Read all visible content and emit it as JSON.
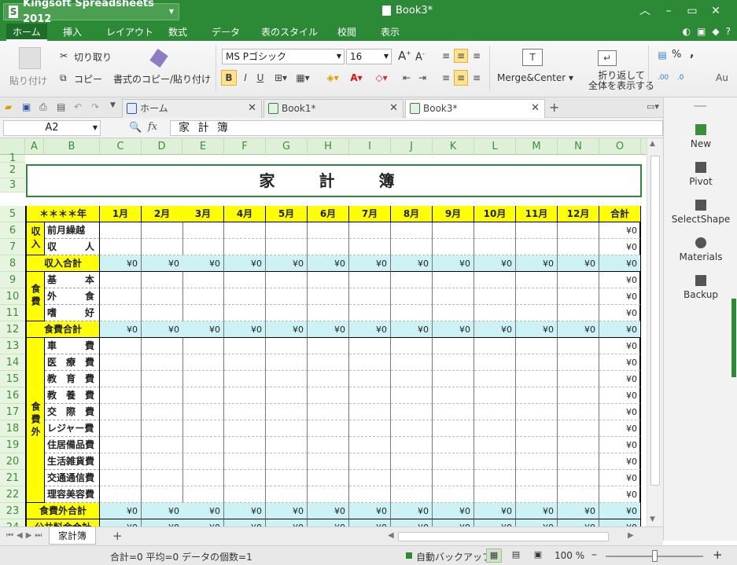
{
  "app": {
    "name": "Kingsoft Spreadsheets 2012",
    "doc_title": "Book3*"
  },
  "menu": [
    "ホーム",
    "挿入",
    "レイアウト",
    "数式",
    "データ",
    "表のスタイル",
    "校閲",
    "表示"
  ],
  "ribbon": {
    "paste": "貼り付け",
    "cut": "切り取り",
    "copy": "コピー",
    "format_painter": "書式のコピー/貼り付け",
    "font_name": "MS Pゴシック",
    "font_size": "16",
    "bold": "B",
    "italic": "I",
    "underline": "U",
    "merge_center": "Merge&Center",
    "wrap_line1": "折り返して",
    "wrap_line2": "全体を表示する",
    "percent": "%",
    "comma": ",",
    "more": "Au"
  },
  "tabs": [
    {
      "label": "ホーム"
    },
    {
      "label": "Book1*"
    },
    {
      "label": "Book3*"
    }
  ],
  "formula": {
    "cell_ref": "A2",
    "fx": "fx",
    "content": "家 計 簿"
  },
  "columns": [
    "A",
    "B",
    "C",
    "D",
    "E",
    "F",
    "G",
    "H",
    "I",
    "J",
    "K",
    "L",
    "M",
    "N",
    "O"
  ],
  "rows": [
    "1",
    "2",
    "3",
    "4",
    "5",
    "6",
    "7",
    "8",
    "9",
    "10",
    "11",
    "12",
    "13",
    "14",
    "15",
    "16",
    "17",
    "18",
    "19",
    "20",
    "21",
    "22",
    "23",
    "24"
  ],
  "sheet": {
    "title": "家　計　簿",
    "year_label": "＊＊＊＊年",
    "months": [
      "1月",
      "2月",
      "3月",
      "4月",
      "5月",
      "6月",
      "7月",
      "8月",
      "9月",
      "10月",
      "11月",
      "12月"
    ],
    "total_label": "合計",
    "income_group": "収入",
    "income_items": [
      "前月繰越",
      "収　　　人"
    ],
    "income_total": "収入合計",
    "food_group": "食費",
    "food_items": [
      "基　　　本",
      "外　　　食",
      "嗜　　　好"
    ],
    "food_total": "食費合計",
    "nonfood_group": "食費外",
    "nonfood_items": [
      "車　　　費",
      "医　療　費",
      "教　育　費",
      "教　養　費",
      "交　際　費",
      "レジャー費",
      "住居備品費",
      "生活雑貨費",
      "交通通信費",
      "理容美容費"
    ],
    "nonfood_total": "食費外合計",
    "utility_total": "公共料金合計",
    "yen": "¥0"
  },
  "side": [
    "New",
    "Pivot",
    "SelectShape",
    "Materials",
    "Backup"
  ],
  "sheet_tab": "家計簿",
  "status": {
    "summary": "合計=0 平均=0 データの個数=1",
    "autobackup": "自動バックアップ",
    "zoom": "100 %"
  }
}
